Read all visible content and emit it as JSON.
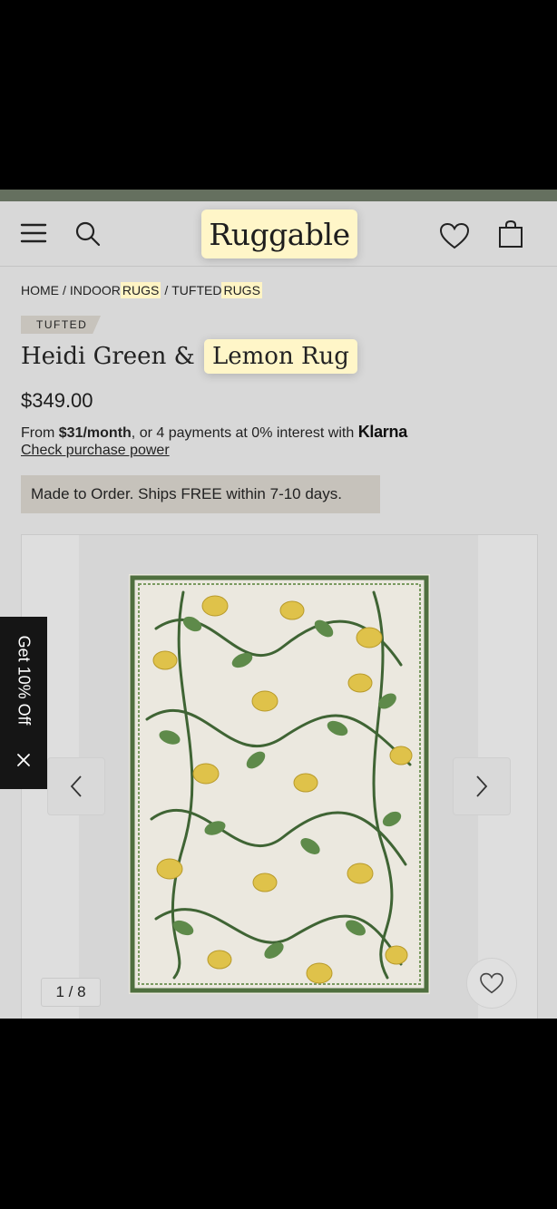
{
  "header": {
    "logo": "Ruggable",
    "icons": [
      "menu-icon",
      "search-icon",
      "heart-icon",
      "shopping-bag-icon"
    ]
  },
  "breadcrumb": {
    "home": "HOME",
    "separator": "/",
    "indoor": "INDOOR",
    "rugs1": "RUGS",
    "tufted": "TUFTED",
    "rugs2": "RUGS"
  },
  "product": {
    "badge": "TUFTED",
    "title_main": "Heidi Green &",
    "title_highlight": "Lemon Rug",
    "price": "$349.00",
    "finance_prefix": "From ",
    "finance_amount": "$31/month",
    "finance_middle": ", or 4 payments at 0% interest with ",
    "finance_brand": "Klarna",
    "check_link": "Check purchase power",
    "shipping": "Made to Order. Ships FREE within 7-10 days."
  },
  "gallery": {
    "counter": "1 / 8"
  },
  "promo": {
    "label": "Get 10% Off"
  },
  "colors": {
    "page_bg": "#d8d8d8",
    "highlight": "#fff6c8",
    "rug_green": "#4f6f3f",
    "rug_yellow": "#e0c548",
    "promo_bg": "#151515"
  }
}
